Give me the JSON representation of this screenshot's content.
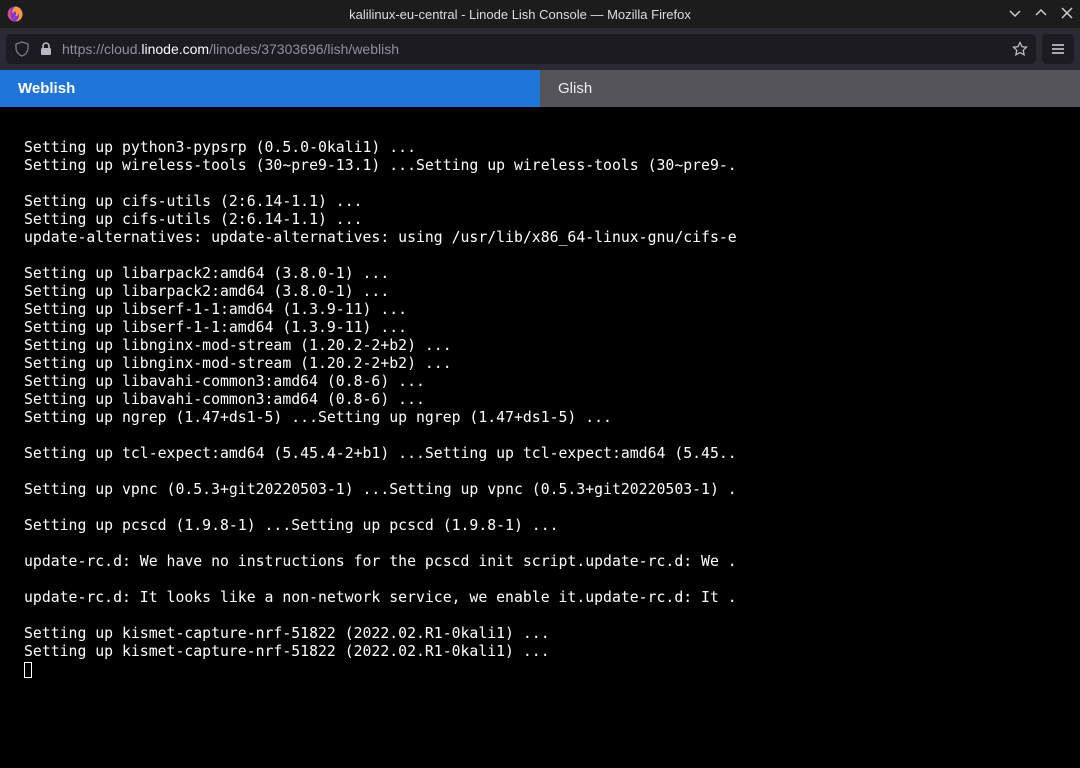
{
  "titlebar": {
    "title": "kalilinux-eu-central - Linode Lish Console — Mozilla Firefox"
  },
  "url": {
    "scheme": "https://",
    "sub": "cloud.",
    "domain": "linode.com",
    "path": "/linodes/37303696/lish/weblish"
  },
  "tabs": {
    "weblish": "Weblish",
    "glish": "Glish"
  },
  "terminal": {
    "lines": [
      "Setting up python3-pypsrp (0.5.0-0kali1) ...",
      "Setting up wireless-tools (30~pre9-13.1) ...Setting up wireless-tools (30~pre9-.",
      "",
      "Setting up cifs-utils (2:6.14-1.1) ...",
      "Setting up cifs-utils (2:6.14-1.1) ...",
      "update-alternatives: update-alternatives: using /usr/lib/x86_64-linux-gnu/cifs-e",
      "",
      "Setting up libarpack2:amd64 (3.8.0-1) ...",
      "Setting up libarpack2:amd64 (3.8.0-1) ...",
      "Setting up libserf-1-1:amd64 (1.3.9-11) ...",
      "Setting up libserf-1-1:amd64 (1.3.9-11) ...",
      "Setting up libnginx-mod-stream (1.20.2-2+b2) ...",
      "Setting up libnginx-mod-stream (1.20.2-2+b2) ...",
      "Setting up libavahi-common3:amd64 (0.8-6) ...",
      "Setting up libavahi-common3:amd64 (0.8-6) ...",
      "Setting up ngrep (1.47+ds1-5) ...Setting up ngrep (1.47+ds1-5) ...",
      "",
      "Setting up tcl-expect:amd64 (5.45.4-2+b1) ...Setting up tcl-expect:amd64 (5.45..",
      "",
      "Setting up vpnc (0.5.3+git20220503-1) ...Setting up vpnc (0.5.3+git20220503-1) .",
      "",
      "Setting up pcscd (1.9.8-1) ...Setting up pcscd (1.9.8-1) ...",
      "",
      "update-rc.d: We have no instructions for the pcscd init script.update-rc.d: We .",
      "",
      "update-rc.d: It looks like a non-network service, we enable it.update-rc.d: It .",
      "",
      "Setting up kismet-capture-nrf-51822 (2022.02.R1-0kali1) ...",
      "Setting up kismet-capture-nrf-51822 (2022.02.R1-0kali1) ..."
    ]
  }
}
